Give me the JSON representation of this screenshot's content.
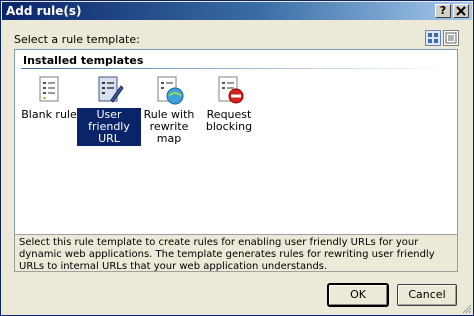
{
  "window": {
    "title": "Add rule(s)",
    "help_button": "?",
    "close_button": "X"
  },
  "select_label": "Select a rule template:",
  "view_buttons": [
    {
      "icon": "large-icons-view-icon",
      "active": true
    },
    {
      "icon": "details-view-icon",
      "active": false
    }
  ],
  "group": {
    "header": "Installed templates",
    "items": [
      {
        "label": "Blank rule",
        "icon": "blank-rule-icon",
        "selected": false
      },
      {
        "label": "User friendly URL",
        "icon": "user-friendly-url-icon",
        "selected": true
      },
      {
        "label": "Rule with rewrite map",
        "icon": "rewrite-map-icon",
        "selected": false
      },
      {
        "label": "Request blocking",
        "icon": "request-blocking-icon",
        "selected": false
      }
    ]
  },
  "description": "Select this rule template to create rules for enabling user friendly URLs for your dynamic web applications. The template generates rules for rewriting user friendly URLs to internal URLs that your web application understands.",
  "buttons": {
    "ok": "OK",
    "cancel": "Cancel"
  },
  "colors": {
    "title_bar": "#0a246a",
    "selection": "#0a246a",
    "dialog_bg": "#ece9d8"
  }
}
